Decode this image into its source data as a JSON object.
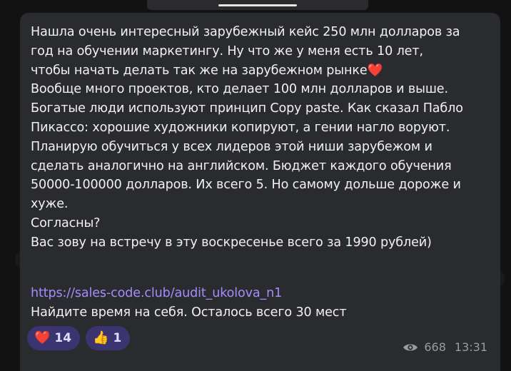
{
  "message": {
    "text_lines": [
      "Нашла очень интересный зарубежный кейс 250 млн долларов за",
      "год на обучении маркетингу. Ну что же у меня есть 10 лет,",
      "чтобы начать делать так же на зарубежном рынке",
      "Вообще много проектов, кто делает 100 млн долларов и выше.",
      "Богатые люди используют принцип Copy paste. Как сказал Пабло",
      "Пикассо: хорошие художники копируют, а гении нагло воруют.",
      "Планирую обучиться у всех лидеров этой ниши зарубежом и",
      "сделать аналогично на английском. Бюджет каждого обучения",
      "50000-100000 долларов. Их всего 5. Но самому дольше дороже и",
      "хуже.",
      "Согласны?",
      "Вас зову на встречу в эту воскресенье всего за 1990 рублей)"
    ],
    "inline_emoji": "❤️",
    "link": "https://sales-code.club/audit_ukolova_n1",
    "footer": "Найдите время на себя. Осталось всего 30 мест"
  },
  "reactions": [
    {
      "emoji": "❤️",
      "count": "14"
    },
    {
      "emoji": "👍",
      "count": "1"
    }
  ],
  "meta": {
    "views_icon": "eye-icon",
    "views": "668",
    "time": "13:31"
  },
  "colors": {
    "bubble": "#2a2b2e",
    "link": "#a78bfa",
    "reaction_bg": "#3b3470"
  }
}
